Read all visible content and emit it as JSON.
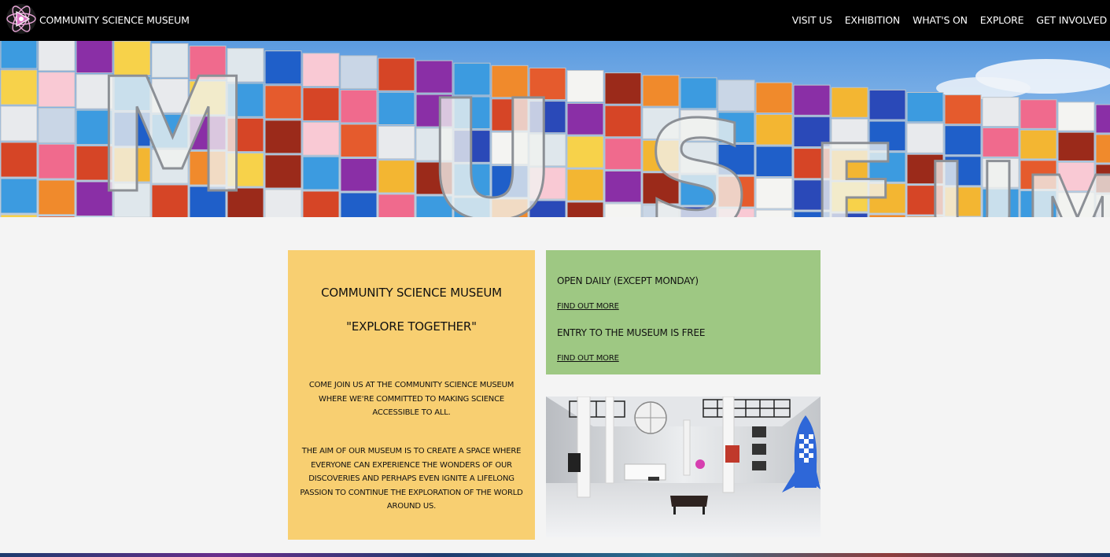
{
  "header": {
    "brand": "COMMUNITY SCIENCE MUSEUM",
    "nav": [
      "VISIT US",
      "EXHIBITION",
      "WHAT'S ON",
      "EXPLORE",
      "GET INVOLVED"
    ]
  },
  "hero": {
    "sign_text": "MUSEUM"
  },
  "intro_card": {
    "title": "COMMUNITY SCIENCE MUSEUM",
    "tagline": "\"EXPLORE TOGETHER\"",
    "paragraph1": "COME JOIN US AT THE COMMUNITY SCIENCE MUSEUM WHERE WE'RE COMMITTED TO MAKING SCIENCE ACCESSIBLE TO ALL.",
    "paragraph2": "THE AIM OF OUR MUSEUM IS TO CREATE A SPACE WHERE EVERYONE CAN EXPERIENCE THE WONDERS OF OUR DISCOVERIES AND PERHAPS EVEN IGNITE A LIFELONG PASSION TO CONTINUE THE EXPLORATION OF THE WORLD AROUND US."
  },
  "info_card": {
    "hours": "OPEN DAILY (EXCEPT MONDAY)",
    "hours_link": "FIND OUT MORE",
    "entry": "ENTRY TO THE MUSEUM IS FREE",
    "entry_link": "FIND OUT MORE"
  },
  "colors": {
    "nav_bg": "#000000",
    "intro_card_bg": "#f8cf71",
    "info_card_bg": "#9ec883",
    "page_bg": "#f4f4f4"
  },
  "icons": {
    "logo": "atom-play-logo-icon"
  }
}
